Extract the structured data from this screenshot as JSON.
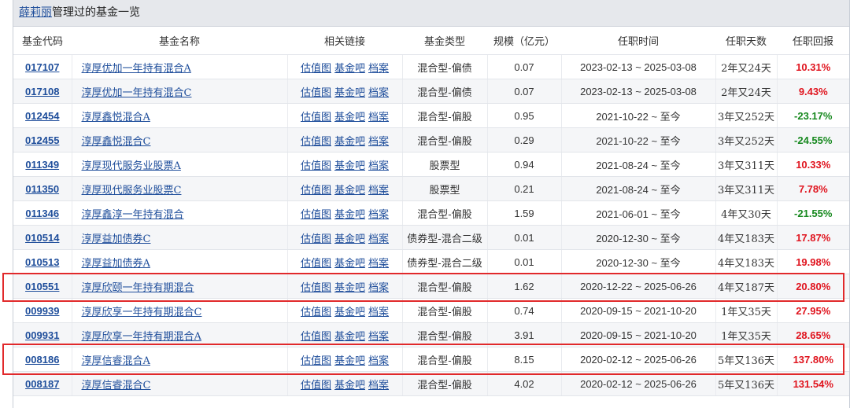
{
  "panel": {
    "manager_name": "薛莉丽",
    "title_suffix": "管理过的基金一览"
  },
  "headers": [
    "基金代码",
    "基金名称",
    "相关链接",
    "基金类型",
    "规模（亿元）",
    "任职时间",
    "任职天数",
    "任职回报"
  ],
  "link_labels": [
    "估值图",
    "基金吧",
    "档案"
  ],
  "colors": {
    "positive": "#e0141e",
    "negative": "#17891f",
    "highlight": "#e1292b"
  },
  "rows": [
    {
      "code": "017107",
      "name": "淳厚优加一年持有混合A",
      "type": "混合型-偏债",
      "size": "0.07",
      "period": "2023-02-13 ~ 2025-03-08",
      "days": "2年又24天",
      "ret": "10.31%",
      "sign": "pos"
    },
    {
      "code": "017108",
      "name": "淳厚优加一年持有混合C",
      "type": "混合型-偏债",
      "size": "0.07",
      "period": "2023-02-13 ~ 2025-03-08",
      "days": "2年又24天",
      "ret": "9.43%",
      "sign": "pos"
    },
    {
      "code": "012454",
      "name": "淳厚鑫悦混合A",
      "type": "混合型-偏股",
      "size": "0.95",
      "period": "2021-10-22 ~ 至今",
      "days": "3年又252天",
      "ret": "-23.17%",
      "sign": "neg"
    },
    {
      "code": "012455",
      "name": "淳厚鑫悦混合C",
      "type": "混合型-偏股",
      "size": "0.29",
      "period": "2021-10-22 ~ 至今",
      "days": "3年又252天",
      "ret": "-24.55%",
      "sign": "neg"
    },
    {
      "code": "011349",
      "name": "淳厚现代服务业股票A",
      "type": "股票型",
      "size": "0.94",
      "period": "2021-08-24 ~ 至今",
      "days": "3年又311天",
      "ret": "10.33%",
      "sign": "pos"
    },
    {
      "code": "011350",
      "name": "淳厚现代服务业股票C",
      "type": "股票型",
      "size": "0.21",
      "period": "2021-08-24 ~ 至今",
      "days": "3年又311天",
      "ret": "7.78%",
      "sign": "pos"
    },
    {
      "code": "011346",
      "name": "淳厚鑫淳一年持有混合",
      "type": "混合型-偏股",
      "size": "1.59",
      "period": "2021-06-01 ~ 至今",
      "days": "4年又30天",
      "ret": "-21.55%",
      "sign": "neg"
    },
    {
      "code": "010514",
      "name": "淳厚益加债券C",
      "type": "债券型-混合二级",
      "size": "0.01",
      "period": "2020-12-30 ~ 至今",
      "days": "4年又183天",
      "ret": "17.87%",
      "sign": "pos"
    },
    {
      "code": "010513",
      "name": "淳厚益加债券A",
      "type": "债券型-混合二级",
      "size": "0.01",
      "period": "2020-12-30 ~ 至今",
      "days": "4年又183天",
      "ret": "19.98%",
      "sign": "pos"
    },
    {
      "code": "010551",
      "name": "淳厚欣颐一年持有期混合",
      "type": "混合型-偏股",
      "size": "1.62",
      "period": "2020-12-22 ~ 2025-06-26",
      "days": "4年又187天",
      "ret": "20.80%",
      "sign": "pos"
    },
    {
      "code": "009939",
      "name": "淳厚欣享一年持有期混合C",
      "type": "混合型-偏股",
      "size": "0.74",
      "period": "2020-09-15 ~ 2021-10-20",
      "days": "1年又35天",
      "ret": "27.95%",
      "sign": "pos"
    },
    {
      "code": "009931",
      "name": "淳厚欣享一年持有期混合A",
      "type": "混合型-偏股",
      "size": "3.91",
      "period": "2020-09-15 ~ 2021-10-20",
      "days": "1年又35天",
      "ret": "28.65%",
      "sign": "pos"
    },
    {
      "code": "008186",
      "name": "淳厚信睿混合A",
      "type": "混合型-偏股",
      "size": "8.15",
      "period": "2020-02-12 ~ 2025-06-26",
      "days": "5年又136天",
      "ret": "137.80%",
      "sign": "pos"
    },
    {
      "code": "008187",
      "name": "淳厚信睿混合C",
      "type": "混合型-偏股",
      "size": "4.02",
      "period": "2020-02-12 ~ 2025-06-26",
      "days": "5年又136天",
      "ret": "131.54%",
      "sign": "pos"
    }
  ]
}
